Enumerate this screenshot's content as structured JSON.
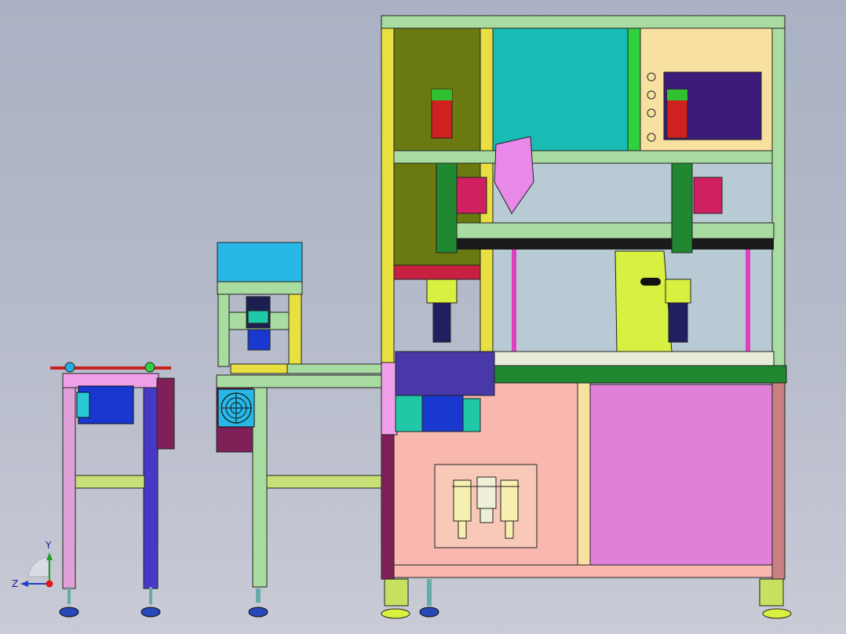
{
  "viewport": {
    "axis_triad": {
      "y_label": "Y",
      "z_label": "Z"
    }
  },
  "colors": {
    "frame_yellow": "#e8e040",
    "frame_green": "#a8dca0",
    "teal_panel": "#18bcb4",
    "cream_panel": "#f8e0a0",
    "navy_panel": "#3c1c78",
    "olive_panel": "#6a7a10",
    "pink_panel": "#f8b8b0",
    "magenta_panel": "#e080d8",
    "blue_motor": "#1838d0",
    "cyan_box": "#28b8e8",
    "robot_yellow": "#d8f040",
    "red_motor": "#d02020",
    "purple_leg": "#4838c8",
    "pink_leg": "#e0a0d8",
    "maroon": "#802058"
  },
  "icons": {
    "axis_triad": "axis-triad-icon",
    "fan": "fan-icon",
    "air_filter": "air-filter-regulator-icon"
  }
}
